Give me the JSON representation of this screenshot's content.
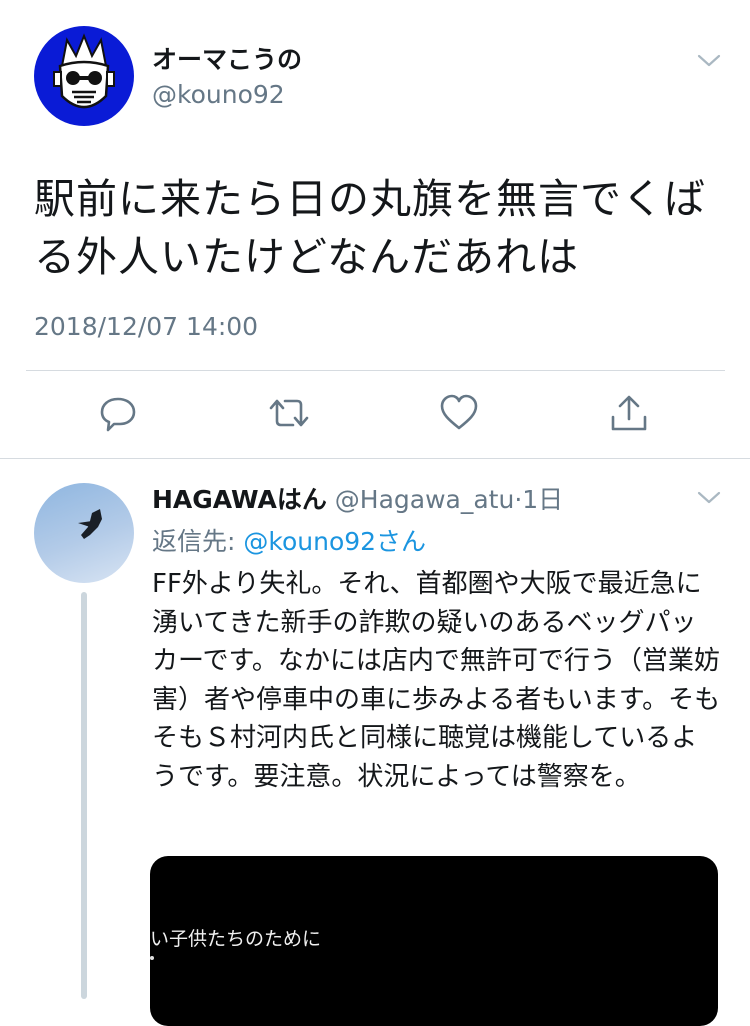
{
  "tweet": {
    "display_name": "オーマこうの",
    "handle": "@kouno92",
    "text": "駅前に来たら日の丸旗を無言でくばる外人いたけどなんだあれは",
    "timestamp": "2018/12/07 14:00",
    "avatar_color": "#0a1bd6"
  },
  "actions": [
    "reply-icon",
    "retweet-icon",
    "like-icon",
    "share-icon"
  ],
  "reply": {
    "display_name": "HAGAWAはん",
    "handle": "@Hagawa_atu",
    "separator": "·",
    "time_ago": "1日",
    "reply_to_label": "返信先: ",
    "reply_to_user": "@kouno92さん",
    "text": "FF外より失礼。それ、首都圏や大阪で最近急に湧いてきた新手の詐欺の疑いのあるベッグパッカーです。なかには店内で無許可で行う（営業妨害）者や停車中の車に歩みよる者もいます。そもそもＳ村河内氏と同様に聴覚は機能しているようです。要注意。状況によっては警察を。",
    "media_caption": "い子供たちのために"
  },
  "colors": {
    "text": "#14171a",
    "secondary": "#657786",
    "link": "#1b95e0",
    "divider": "#d6dbe0"
  }
}
